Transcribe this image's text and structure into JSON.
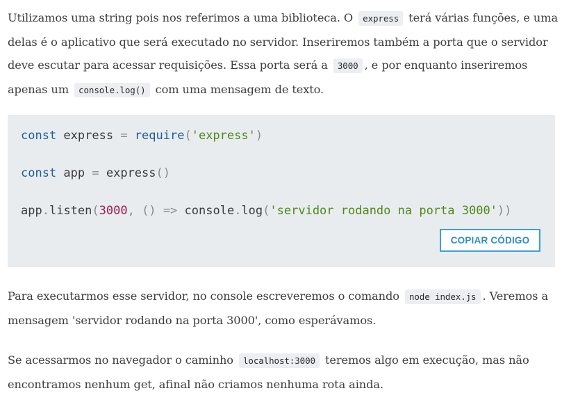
{
  "paragraph1": {
    "t1": "Utilizamos uma string pois nos referimos a uma biblioteca. O",
    "c1": "express",
    "t2": "terá várias funções, e uma delas é o aplicativo que será executado no servidor. Inseriremos também a porta que o servidor deve escutar para acessar requisições. Essa porta será a",
    "c2": "3000",
    "t3": ", e por enquanto inseriremos apenas um",
    "c3": "console.log()",
    "t4": "com uma mensagem de texto."
  },
  "code": {
    "line1": {
      "kw": "const",
      "sp1": " express ",
      "eq": "=",
      "sp2": " ",
      "fn": "require",
      "p1": "(",
      "str": "'express'",
      "p2": ")"
    },
    "line2": {
      "kw": "const",
      "sp1": " app ",
      "eq": "=",
      "sp2": " express",
      "p1": "()"
    },
    "line3": {
      "obj": "app",
      "dot": ".",
      "fn": "listen",
      "p1": "(",
      "num": "3000",
      "comma": ", ",
      "p2": "()",
      "sp1": " ",
      "arrow": "=>",
      "sp2": " console",
      "dot2": ".",
      "fn2": "log",
      "p3": "(",
      "str": "'servidor rodando na porta 3000'",
      "p4": "))"
    },
    "copy_label": "COPIAR CÓDIGO"
  },
  "paragraph2": {
    "t1": "Para executarmos esse servidor, no console escreveremos o comando",
    "c1": "node index.js",
    "t2": ". Veremos a mensagem 'servidor rodando na porta 3000', como esperávamos."
  },
  "paragraph3": {
    "t1": "Se acessarmos no navegador o caminho",
    "c1": "localhost:3000",
    "t2": "teremos algo em execução, mas não encontramos nenhum get, afinal não criamos nenhuma rota ainda."
  }
}
